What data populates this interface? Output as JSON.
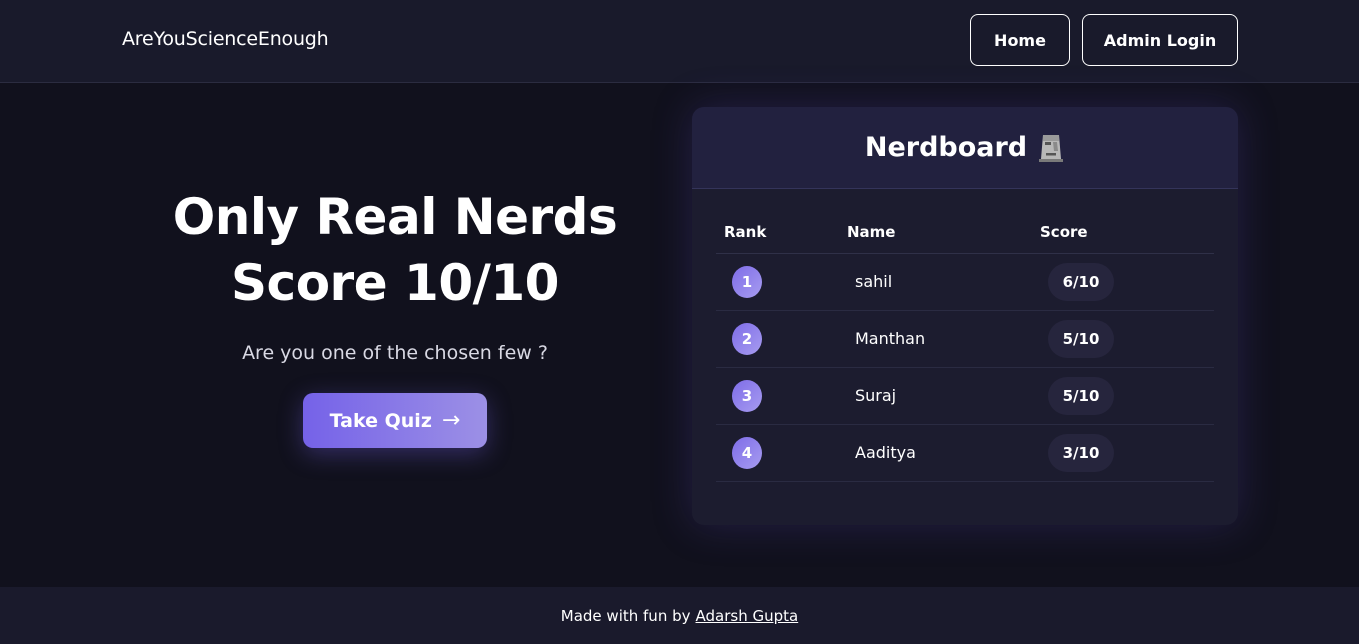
{
  "header": {
    "brand": "AreYouScienceEnough",
    "nav": [
      {
        "label": "Home"
      },
      {
        "label": "Admin Login"
      }
    ]
  },
  "hero": {
    "title_line1": "Only Real Nerds",
    "title_line2": "Score 10/10",
    "subtitle": "Are you one of the chosen few ?",
    "cta_label": "Take Quiz",
    "cta_arrow": "→"
  },
  "leaderboard": {
    "title": "Nerdboard",
    "icon": "moai-icon",
    "columns": [
      "Rank",
      "Name",
      "Score"
    ],
    "rows": [
      {
        "rank": "1",
        "name": "sahil",
        "score": "6/10"
      },
      {
        "rank": "2",
        "name": "Manthan",
        "score": "5/10"
      },
      {
        "rank": "3",
        "name": "Suraj",
        "score": "5/10"
      },
      {
        "rank": "4",
        "name": "Aaditya",
        "score": "3/10"
      }
    ]
  },
  "footer": {
    "text": "Made with fun by",
    "author": "Adarsh Gupta"
  },
  "colors": {
    "background": "#11111d",
    "header": "#191a2b",
    "accent_start": "#7562e8",
    "accent_end": "#9c90e6",
    "card": "#1c1c2f"
  }
}
